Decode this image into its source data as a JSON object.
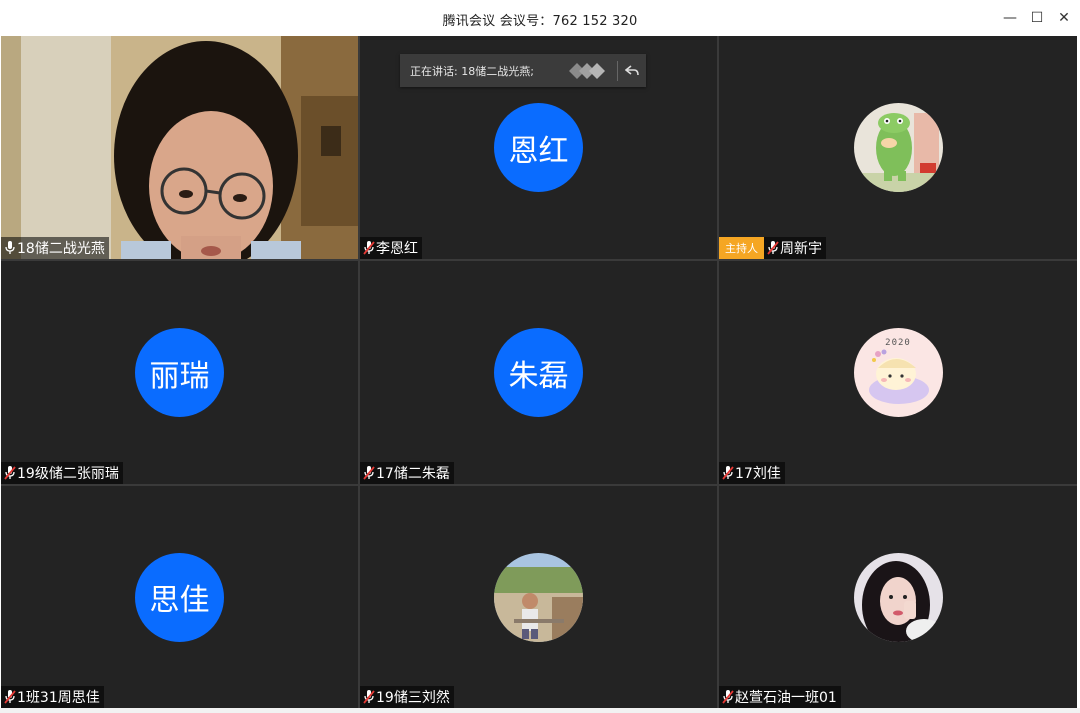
{
  "window": {
    "title": "腾讯会议 会议号：762 152 320",
    "minimize_glyph": "—",
    "maximize_glyph": "☐",
    "close_glyph": "✕"
  },
  "speaking": {
    "label": "正在讲话: 18储二战光燕;"
  },
  "host_badge": "主持人",
  "participants": [
    {
      "name": "18储二战光燕",
      "mic": "on",
      "type": "video"
    },
    {
      "name": "李恩红",
      "mic": "muted",
      "type": "initials",
      "initials": "恩红"
    },
    {
      "name": "周新宇",
      "mic": "muted",
      "type": "image",
      "host": true
    },
    {
      "name": "19级储二张丽瑞",
      "mic": "muted",
      "type": "initials",
      "initials": "丽瑞"
    },
    {
      "name": "17储二朱磊",
      "mic": "muted",
      "type": "initials",
      "initials": "朱磊"
    },
    {
      "name": "17刘佳",
      "mic": "muted",
      "type": "image",
      "caption": "2020"
    },
    {
      "name": "1班31周思佳",
      "mic": "muted",
      "type": "initials",
      "initials": "思佳"
    },
    {
      "name": "19储三刘然",
      "mic": "muted",
      "type": "image"
    },
    {
      "name": "赵萱石油一班01",
      "mic": "muted",
      "type": "image"
    }
  ],
  "colors": {
    "avatar_blue": "#0a6cff",
    "host_orange": "#f5a623",
    "tile_bg": "#232323",
    "muted_red": "#e53935"
  }
}
